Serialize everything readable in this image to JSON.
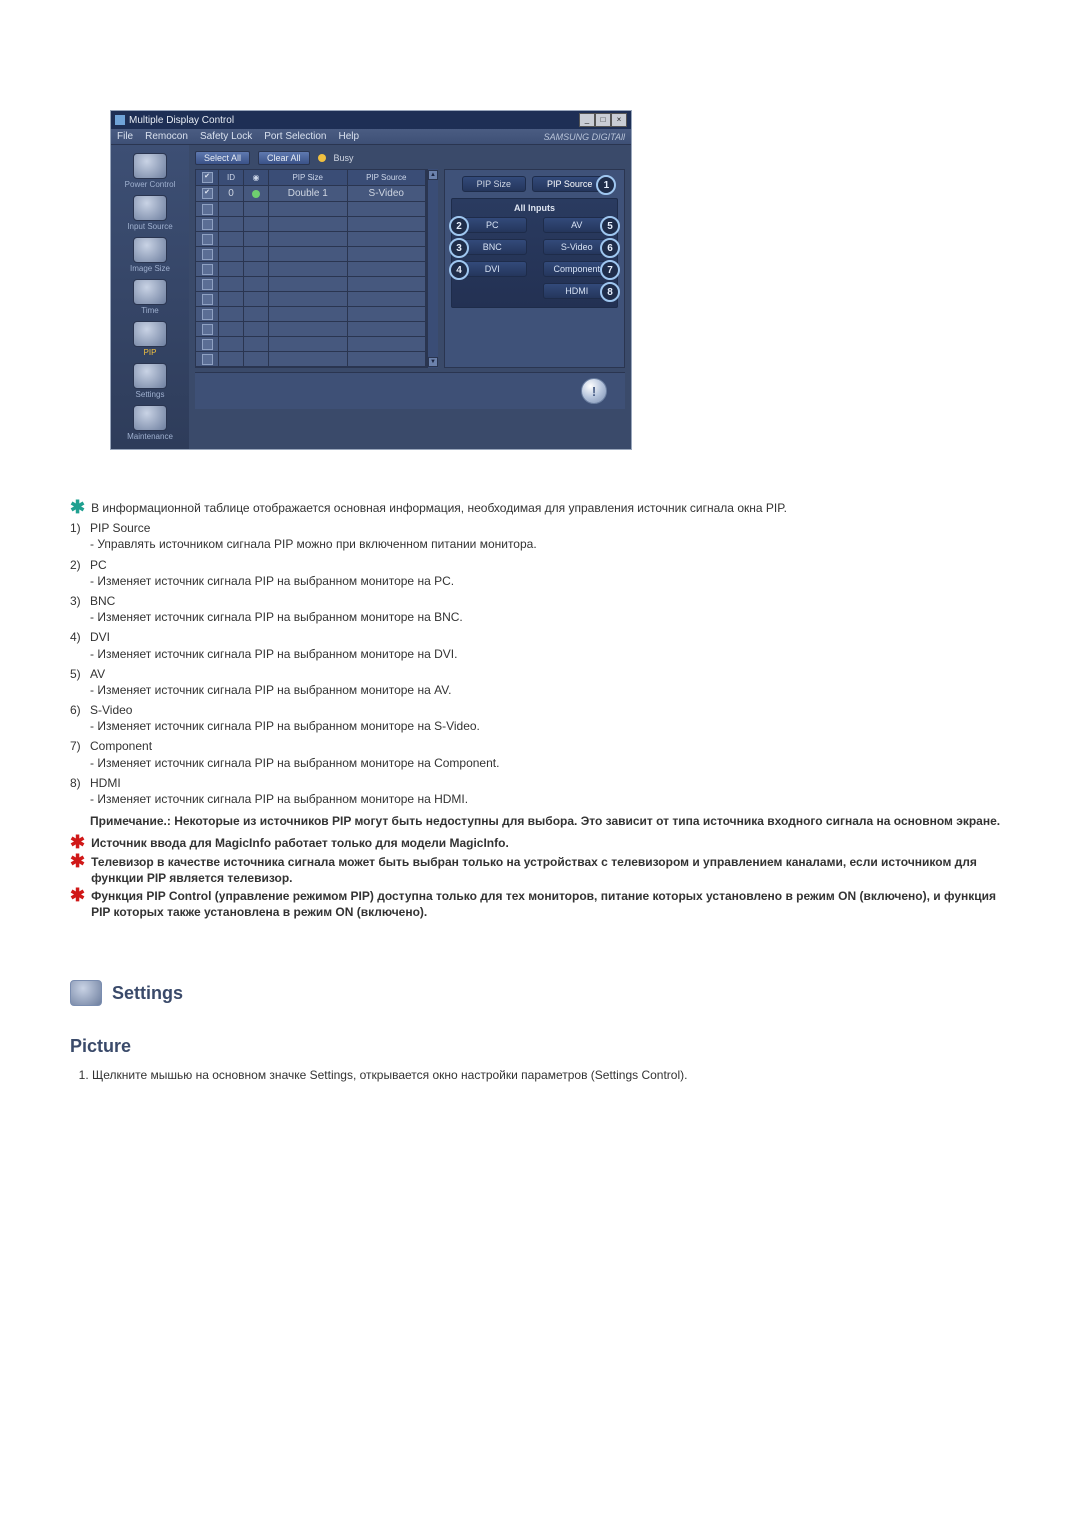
{
  "app": {
    "title": "Multiple Display Control",
    "menus": [
      "File",
      "Remocon",
      "Safety Lock",
      "Port Selection",
      "Help"
    ],
    "brand": "SAMSUNG DIGITAll"
  },
  "sidebar": {
    "items": [
      {
        "label": "Power Control"
      },
      {
        "label": "Input Source"
      },
      {
        "label": "Image Size"
      },
      {
        "label": "Time"
      },
      {
        "label": "PIP",
        "active": true
      },
      {
        "label": "Settings"
      },
      {
        "label": "Maintenance"
      }
    ]
  },
  "toolbar": {
    "select_all": "Select All",
    "clear_all": "Clear All",
    "busy": "Busy"
  },
  "table": {
    "headers": {
      "id": "ID",
      "size": "PIP Size",
      "source": "PIP Source"
    },
    "rows": [
      {
        "checked": true,
        "id": "0",
        "status": "green",
        "size": "Double 1",
        "source": "S-Video"
      }
    ],
    "blank_count": 11
  },
  "panel": {
    "tab_size": "PIP Size",
    "tab_source": "PIP Source",
    "all_inputs_title": "All Inputs",
    "buttons": {
      "pc": "PC",
      "bnc": "BNC",
      "dvi": "DVI",
      "av": "AV",
      "svideo": "S-Video",
      "component": "Component",
      "hdmi": "HDMI"
    },
    "callouts": {
      "c1": "1",
      "c2": "2",
      "c3": "3",
      "c4": "4",
      "c5": "5",
      "c6": "6",
      "c7": "7",
      "c8": "8"
    }
  },
  "doc": {
    "intro": "В информационной таблице отображается основная информация, необходимая для управления источник сигнала окна PIP.",
    "items": [
      {
        "n": "1)",
        "t": "PIP Source",
        "d": "- Управлять источником сигнала PIP можно при включенном питании монитора."
      },
      {
        "n": "2)",
        "t": "PC",
        "d": "- Изменяет источник сигнала PIP на выбранном мониторе на PC."
      },
      {
        "n": "3)",
        "t": "BNC",
        "d": "- Изменяет источник сигнала PIP на выбранном мониторе на BNC."
      },
      {
        "n": "4)",
        "t": "DVI",
        "d": "- Изменяет источник сигнала PIP на выбранном мониторе на DVI."
      },
      {
        "n": "5)",
        "t": "AV",
        "d": "- Изменяет источник сигнала PIP на выбранном мониторе на AV."
      },
      {
        "n": "6)",
        "t": "S-Video",
        "d": "- Изменяет источник сигнала PIP на выбранном мониторе на S-Video."
      },
      {
        "n": "7)",
        "t": "Component",
        "d": "- Изменяет источник сигнала PIP на выбранном мониторе на Component."
      },
      {
        "n": "8)",
        "t": "HDMI",
        "d": "- Изменяет источник сигнала PIP на выбранном мониторе на HDMI."
      }
    ],
    "note_bold": "Примечание.: Некоторые из источников PIP могут быть недоступны для выбора. Это зависит от типа источника входного сигнала на основном экране.",
    "star1": "Источник ввода для MagicInfo работает только для модели MagicInfo.",
    "star2": "Телевизор в качестве источника сигнала может быть выбран только на устройствах с телевизором и управлением каналами, если источником для функции PIP является телевизор.",
    "star3": "Функция PIP Control (управление режимом PIP) доступна только для тех мониторов, питание которых установлено в режим ON (включено), и функция PIP которых также установлена в режим ON (включено).",
    "settings_title": "Settings",
    "picture_title": "Picture",
    "picture_step": "Щелкните мышью на основном значке Settings, открывается окно настройки параметров (Settings Control)."
  }
}
